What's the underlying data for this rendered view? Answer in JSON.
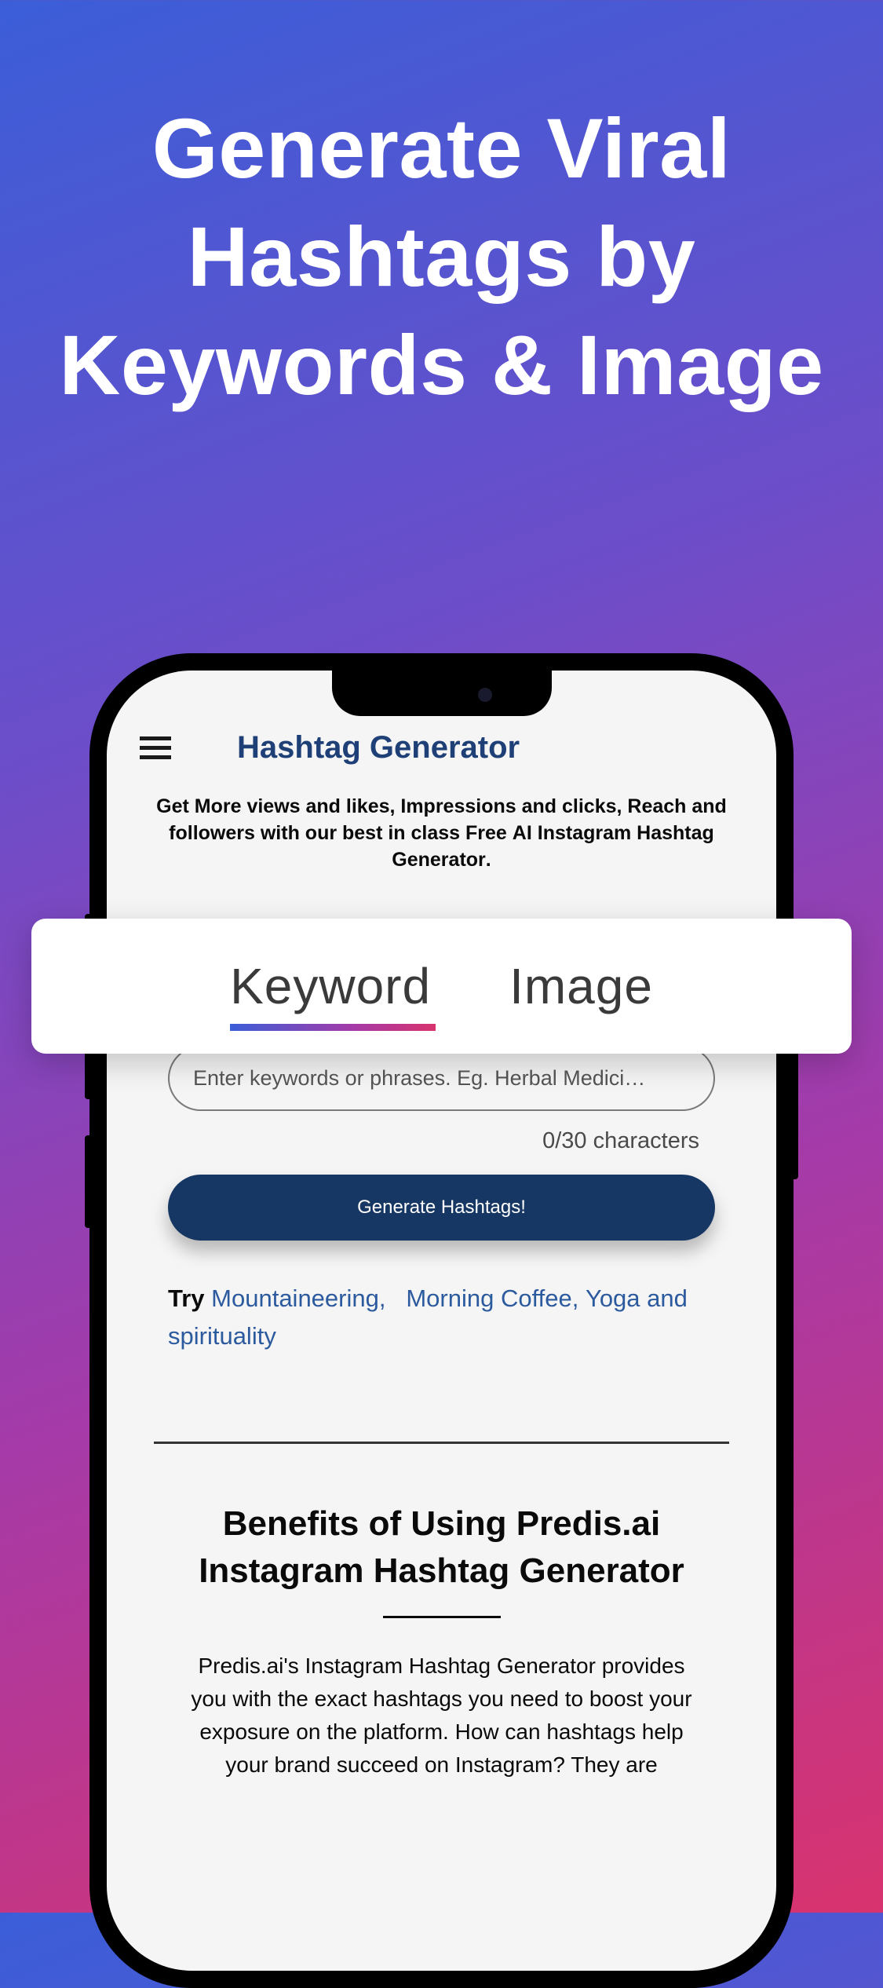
{
  "hero": {
    "title": "Generate Viral Hashtags by Keywords & Image"
  },
  "app": {
    "title": "Hashtag Generator",
    "subtitle_pre": "Get More views and likes, Impressions and clicks, Reach and followers with our best in class Free ",
    "subtitle_bold": "AI Instagram Hashtag Generator",
    "subtitle_post": ".",
    "input_placeholder": "Enter keywords or phrases. Eg. Herbal Medici…",
    "char_count": "0/30 characters",
    "generate_label": "Generate Hashtags!",
    "try_label": "Try ",
    "try_links": [
      "Mountaineering,",
      "Morning Coffee,",
      "Yoga and spirituality"
    ],
    "benefits_title": "Benefits of Using Predis.ai Instagram Hashtag Generator",
    "benefits_text": "Predis.ai's Instagram Hashtag Generator provides you with the exact hashtags you need to boost your exposure on the platform. How can hashtags help your brand succeed on Instagram? They are"
  },
  "tabs": {
    "keyword": "Keyword",
    "image": "Image"
  }
}
